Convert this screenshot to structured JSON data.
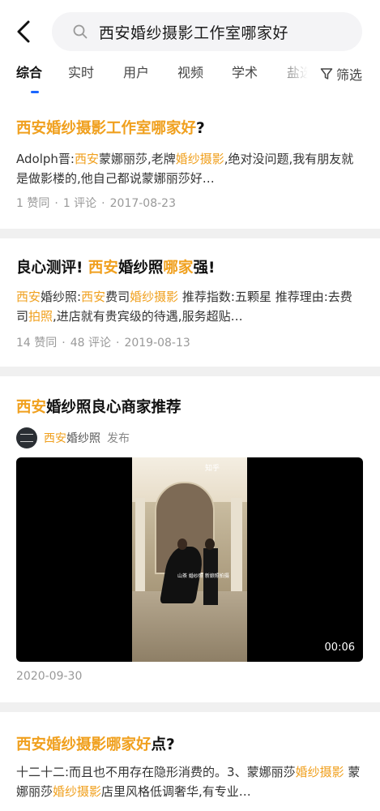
{
  "search": {
    "query": "西安婚纱摄影工作室哪家好"
  },
  "tabs": [
    "综合",
    "实时",
    "用户",
    "视频",
    "学术",
    "盐选"
  ],
  "filter_label": "筛选",
  "colors": {
    "highlight": "#f0a01e",
    "accent": "#1a66ff"
  },
  "results": [
    {
      "title": [
        [
          "西安婚纱摄影工作室哪家好",
          true
        ],
        [
          "?",
          false
        ]
      ],
      "body": [
        [
          "Adolph晋:",
          false
        ],
        [
          "西安",
          true
        ],
        [
          "蒙娜丽莎,老牌",
          false
        ],
        [
          "婚纱摄影",
          true
        ],
        [
          ",绝对没问题,我有朋友就是做影楼的,他自己都说蒙娜丽莎好…",
          false
        ]
      ],
      "likes": "1 赞同",
      "comments": "1 评论",
      "date": "2017-08-23"
    },
    {
      "title": [
        [
          "良心测评! ",
          false
        ],
        [
          "西安",
          true
        ],
        [
          "婚纱照",
          false
        ],
        [
          "哪家",
          true
        ],
        [
          "强!",
          false
        ]
      ],
      "body": [
        [
          "西安",
          true
        ],
        [
          "婚纱照:",
          false
        ],
        [
          "西安",
          true
        ],
        [
          "费司",
          false
        ],
        [
          "婚纱摄影",
          true
        ],
        [
          " 推荐指数:五颗星 推荐理由:去费司",
          false
        ],
        [
          "拍照",
          true
        ],
        [
          ",进店就有贵宾级的待遇,服务超贴…",
          false
        ]
      ],
      "likes": "14 赞同",
      "comments": "48 评论",
      "date": "2019-08-13"
    },
    {
      "title": [
        [
          "西安",
          true
        ],
        [
          "婚纱照良心商家推荐",
          false
        ]
      ],
      "author": [
        [
          "西安",
          true
        ],
        [
          "婚纱照",
          false
        ]
      ],
      "author_suffix": "发布",
      "video_watermark": "知乎",
      "video_caption": "山茶 婚纱照 新娘照拍摄",
      "video_duration": "00:06",
      "date": "2020-09-30"
    },
    {
      "title": [
        [
          "西安婚纱摄影哪家好",
          true
        ],
        [
          "点?",
          false
        ]
      ],
      "body": [
        [
          "十二十二:而且也不用存在隐形消费的。3、蒙娜丽莎",
          false
        ],
        [
          "婚纱摄影",
          true
        ],
        [
          " 蒙娜丽莎",
          false
        ],
        [
          "婚纱摄影",
          true
        ],
        [
          "店里风格低调奢华,有专业…",
          false
        ]
      ]
    }
  ]
}
